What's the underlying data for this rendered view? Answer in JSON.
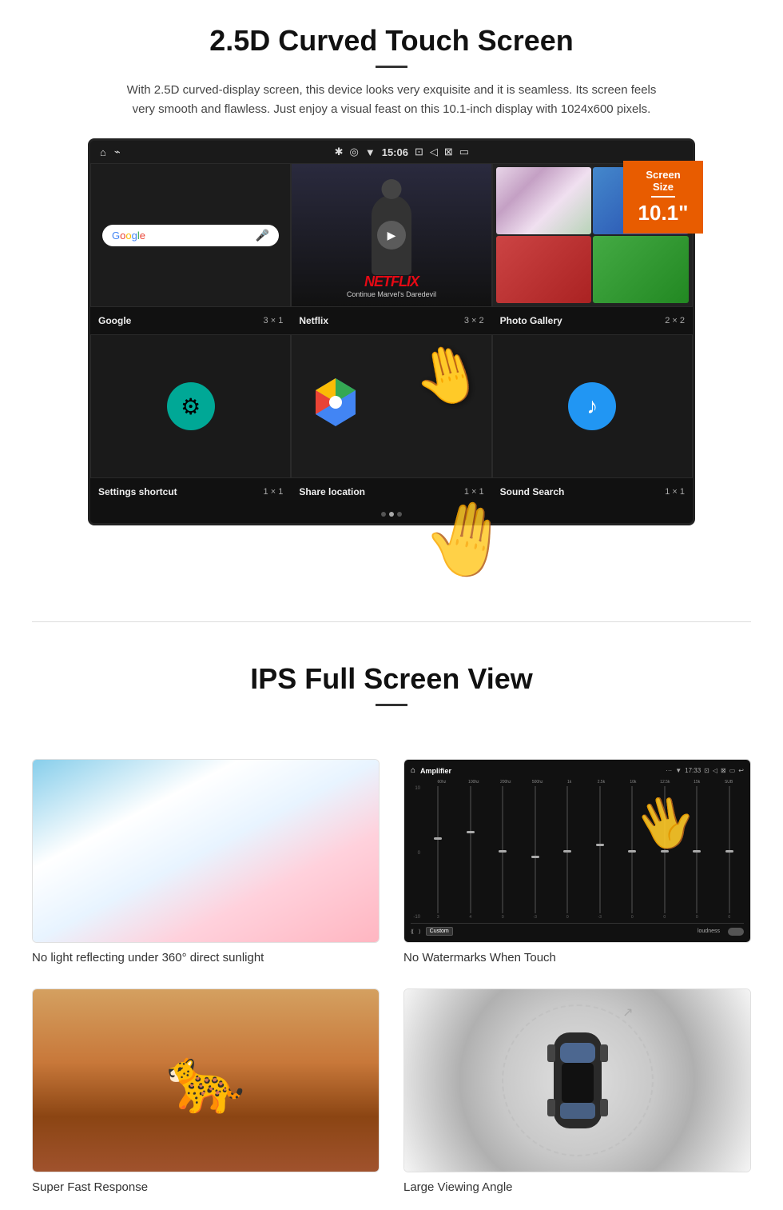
{
  "section1": {
    "title": "2.5D Curved Touch Screen",
    "description": "With 2.5D curved-display screen, this device looks very exquisite and it is seamless. Its screen feels very smooth and flawless. Just enjoy a visual feast on this 10.1-inch display with 1024x600 pixels.",
    "screen_size_badge": {
      "label": "Screen Size",
      "size": "10.1\""
    },
    "status_bar": {
      "time": "15:06"
    },
    "apps": [
      {
        "name": "Google",
        "size": "3 × 1"
      },
      {
        "name": "Netflix",
        "size": "3 × 2",
        "netflix_text": "NETFLIX",
        "netflix_subtitle": "Continue Marvel's Daredevil"
      },
      {
        "name": "Photo Gallery",
        "size": "2 × 2"
      },
      {
        "name": "Settings shortcut",
        "size": "1 × 1"
      },
      {
        "name": "Share location",
        "size": "1 × 1"
      },
      {
        "name": "Sound Search",
        "size": "1 × 1"
      }
    ]
  },
  "section2": {
    "title": "IPS Full Screen View",
    "features": [
      {
        "id": "sunlight",
        "caption": "No light reflecting under 360° direct sunlight"
      },
      {
        "id": "watermark",
        "caption": "No Watermarks When Touch"
      },
      {
        "id": "cheetah",
        "caption": "Super Fast Response"
      },
      {
        "id": "car",
        "caption": "Large Viewing Angle"
      }
    ],
    "amplifier": {
      "title": "Amplifier",
      "time": "17:33",
      "eq_labels": [
        "60hz",
        "100hz",
        "200hz",
        "500hz",
        "1k",
        "2.5k",
        "10k",
        "12.5k",
        "15k",
        "SUB"
      ],
      "preset": "Custom",
      "loudness_label": "loudness",
      "labels_left": [
        "10",
        "0",
        "-10"
      ]
    }
  }
}
